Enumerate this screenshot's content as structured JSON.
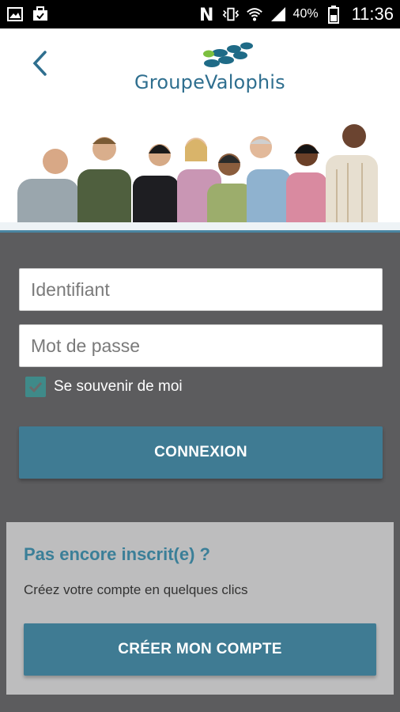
{
  "status_bar": {
    "battery_percent": "40%",
    "time": "11:36",
    "icons": [
      "image-icon",
      "briefcase-icon",
      "nfc-icon",
      "vibrate-icon",
      "wifi-icon",
      "signal-icon",
      "battery-icon"
    ]
  },
  "header": {
    "back_icon": "chevron-left-icon",
    "logo_text": "GroupeValophis",
    "logo_colors": {
      "green": "#7cbf3f",
      "blue": "#2f6f8f"
    }
  },
  "login": {
    "identifier_placeholder": "Identifiant",
    "password_placeholder": "Mot de passe",
    "remember_label": "Se souvenir de moi",
    "remember_checked": true,
    "login_button": "CONNEXION"
  },
  "register": {
    "title": "Pas encore inscrit(e) ?",
    "description": "Créez votre compte en quelques clics",
    "button": "CRÉER MON COMPTE"
  },
  "colors": {
    "accent": "#3f7b93",
    "checkbox": "#3f8a89",
    "background": "#5c5c5e",
    "card": "#bdbdbe"
  }
}
